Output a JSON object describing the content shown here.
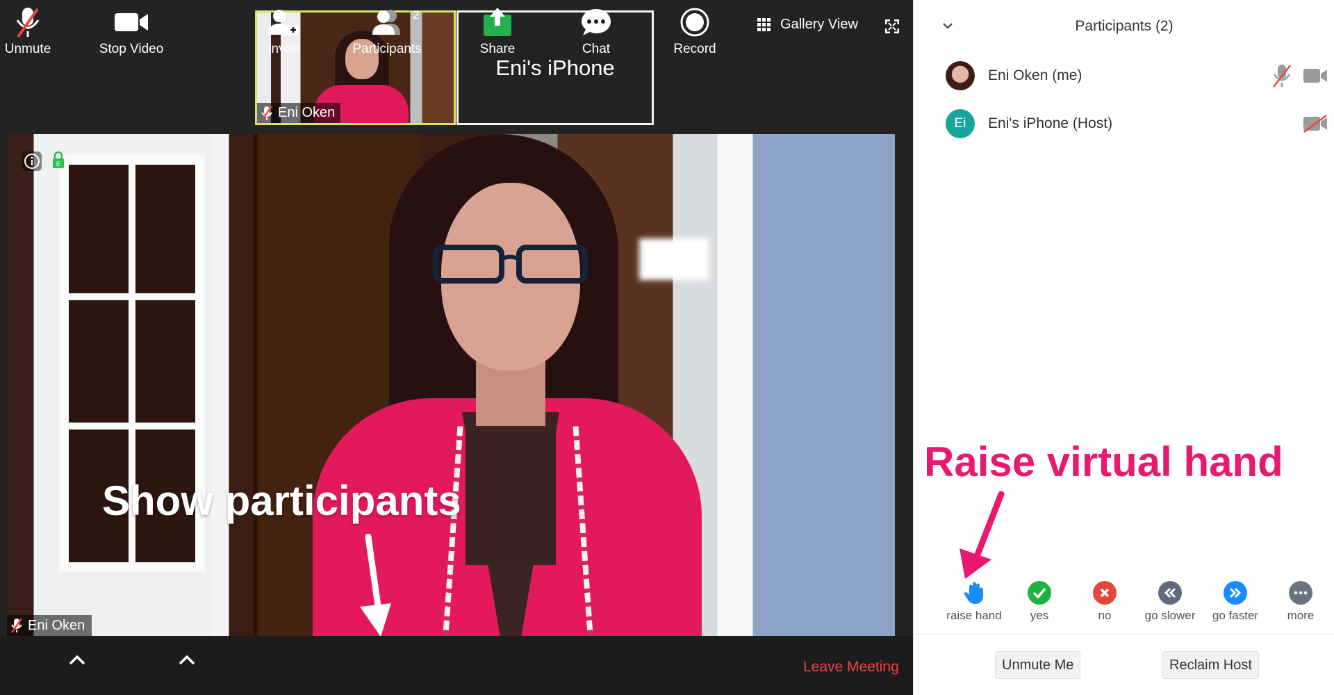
{
  "thumbnails": {
    "self_name": "Eni Oken",
    "iphone_name": "Eni's iPhone"
  },
  "view": {
    "gallery_label": "Gallery View"
  },
  "main_video": {
    "name": "Eni Oken"
  },
  "annotations": {
    "show_participants": "Show participants",
    "raise_hand": "Raise virtual hand"
  },
  "toolbar": {
    "unmute": "Unmute",
    "stop_video": "Stop Video",
    "invite": "Invite",
    "participants": "Participants",
    "participants_count": "2",
    "share": "Share",
    "chat": "Chat",
    "record": "Record",
    "leave": "Leave Meeting"
  },
  "panel": {
    "title": "Participants (2)",
    "participants": [
      {
        "name": "Eni Oken (me)",
        "avatar": "photo"
      },
      {
        "name": "Eni's iPhone (Host)",
        "avatar": "Ei"
      }
    ],
    "reactions": [
      {
        "label": "raise hand",
        "icon": "hand-icon"
      },
      {
        "label": "yes",
        "icon": "check-icon"
      },
      {
        "label": "no",
        "icon": "x-icon"
      },
      {
        "label": "go slower",
        "icon": "rewind-icon"
      },
      {
        "label": "go faster",
        "icon": "fast-forward-icon"
      },
      {
        "label": "more",
        "icon": "ellipsis-icon"
      }
    ],
    "unmute_me": "Unmute Me",
    "reclaim_host": "Reclaim Host"
  },
  "colors": {
    "accent_pink": "#e8196e",
    "leave_red": "#ef4444",
    "share_green": "#22b14c",
    "yes_green": "#1fb141",
    "no_red": "#e5473a",
    "slower_gray": "#5f6b7a",
    "faster_blue": "#1a8cff",
    "host_teal": "#1aa59a"
  }
}
